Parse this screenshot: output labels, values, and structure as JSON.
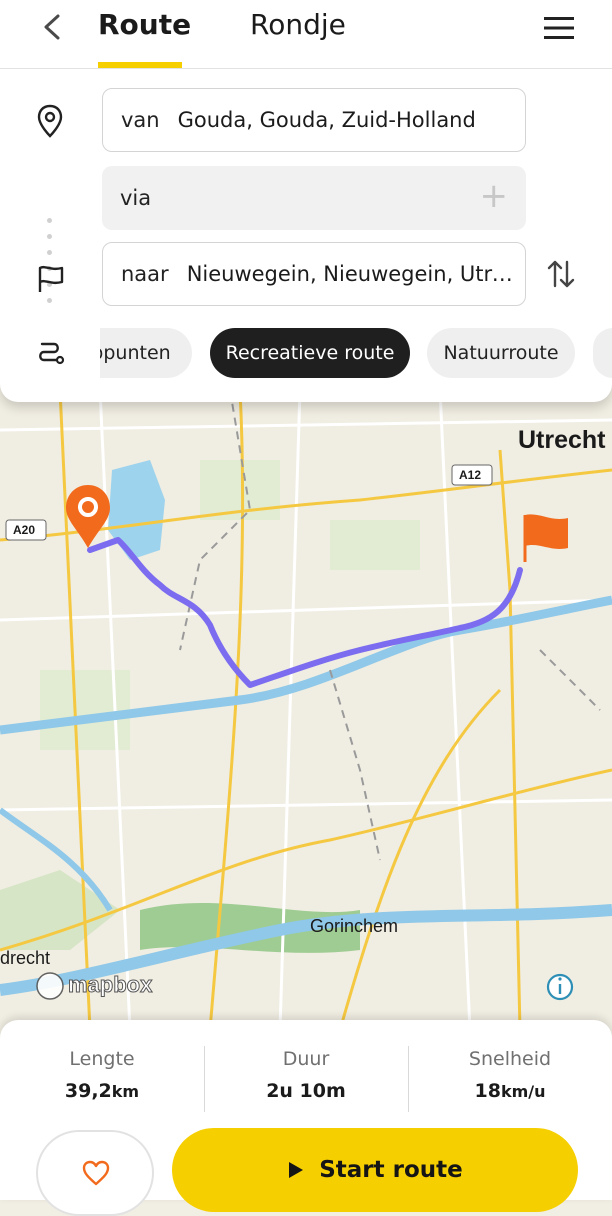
{
  "header": {
    "tabs": [
      {
        "label": "Route",
        "active": true
      },
      {
        "label": "Rondje",
        "active": false
      }
    ],
    "icons": [
      "back-chevron-icon",
      "menu-icon"
    ]
  },
  "route": {
    "from": {
      "label": "van",
      "value": "Gouda, Gouda, Zuid-Holland"
    },
    "via": {
      "label": "via"
    },
    "to": {
      "label": "naar",
      "value": "Nieuwegein, Nieuwegein, Utrec..."
    },
    "chips": [
      {
        "label": "ppunten",
        "selected": false
      },
      {
        "label": "Recreatieve route",
        "selected": true
      },
      {
        "label": "Natuurroute",
        "selected": false
      }
    ]
  },
  "map": {
    "labels": {
      "utrecht": "Utrecht",
      "gorinchem": "Gorinchem",
      "dordrecht": "drecht",
      "a12": "A12",
      "a20": "A20",
      "mapbox": "mapbox"
    },
    "route_color": "#7b6cf0"
  },
  "stats": [
    {
      "key": "Lengte",
      "value": "39,2",
      "unit": "km"
    },
    {
      "key": "Duur",
      "value": "2u 10m",
      "unit": ""
    },
    {
      "key": "Snelheid",
      "value": "18",
      "unit": "km/u"
    }
  ],
  "actions": {
    "start_label": "Start route"
  },
  "colors": {
    "accent": "#f6cf00",
    "pin": "#f26b1d",
    "dark_chip": "#1f1f1f"
  }
}
